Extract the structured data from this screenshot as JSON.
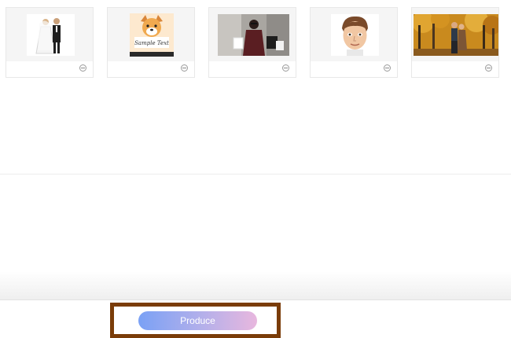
{
  "thumbnails": [
    {
      "subject": "wedding-couple-figurine",
      "colors": {
        "bg": "#ffffff",
        "accent": "#2b2b2b"
      }
    },
    {
      "subject": "dog-sample-card",
      "caption": "Sample Text",
      "colors": {
        "bg": "#fde9cf",
        "accent": "#e59a4a"
      }
    },
    {
      "subject": "woman-shopping-bags",
      "colors": {
        "bg": "#a7a49f",
        "accent": "#5a1e22"
      }
    },
    {
      "subject": "cartoon-avatar",
      "colors": {
        "bg": "#ffffff",
        "accent": "#7a4a2a"
      }
    },
    {
      "subject": "couple-autumn-forest",
      "colors": {
        "bg": "#c98a1e",
        "accent": "#3c2a14"
      }
    }
  ],
  "produce_button": {
    "label": "Produce"
  },
  "colors": {
    "highlight_frame": "#7a3c08",
    "button_gradient": [
      "#7aa1f5",
      "#e8b7de"
    ]
  }
}
